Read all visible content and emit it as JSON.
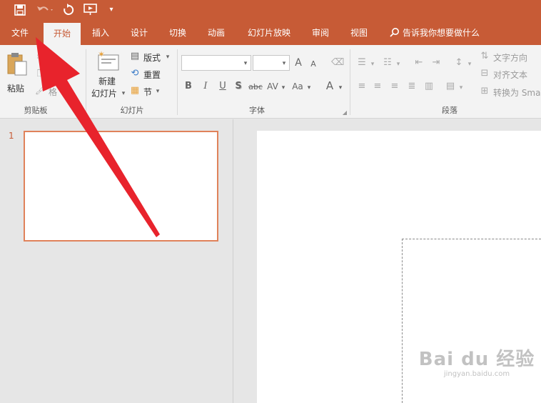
{
  "qat": {
    "save_icon": "save-icon",
    "undo_icon": "undo-icon",
    "redo_icon": "repeat-icon",
    "start_icon": "slideshow-start-icon",
    "customize_icon": "customize-qat-icon"
  },
  "tabs": [
    {
      "label": "文件"
    },
    {
      "label": "开始"
    },
    {
      "label": "插入"
    },
    {
      "label": "设计"
    },
    {
      "label": "切换"
    },
    {
      "label": "动画"
    },
    {
      "label": "幻灯片放映"
    },
    {
      "label": "审阅"
    },
    {
      "label": "视图"
    }
  ],
  "tell_me": "告诉我你想要做什么",
  "ribbon": {
    "clipboard": {
      "paste": "粘贴",
      "format_painter": "格",
      "label": "剪贴板"
    },
    "slides": {
      "new_slide_line1": "新建",
      "new_slide_line2": "幻灯片",
      "layout": "版式",
      "reset": "重置",
      "section": "节",
      "label": "幻灯片"
    },
    "font": {
      "bold": "B",
      "italic": "I",
      "underline": "U",
      "shadow": "S",
      "strike": "abc",
      "spacing": "AV",
      "case": "Aa",
      "color": "A",
      "grow": "A",
      "shrink": "A",
      "label": "字体"
    },
    "paragraph": {
      "text_direction": "文字方向",
      "align_text": "对齐文本",
      "convert_smartart": "转换为 Sma",
      "label": "段落"
    }
  },
  "slides_panel": {
    "slide_number": "1"
  },
  "watermark": {
    "main": "Bai du 经验",
    "sub": "jingyan.baidu.com"
  },
  "colors": {
    "accent": "#c75b36",
    "thumb_border": "#e0825a",
    "arrow": "#e8232c"
  }
}
